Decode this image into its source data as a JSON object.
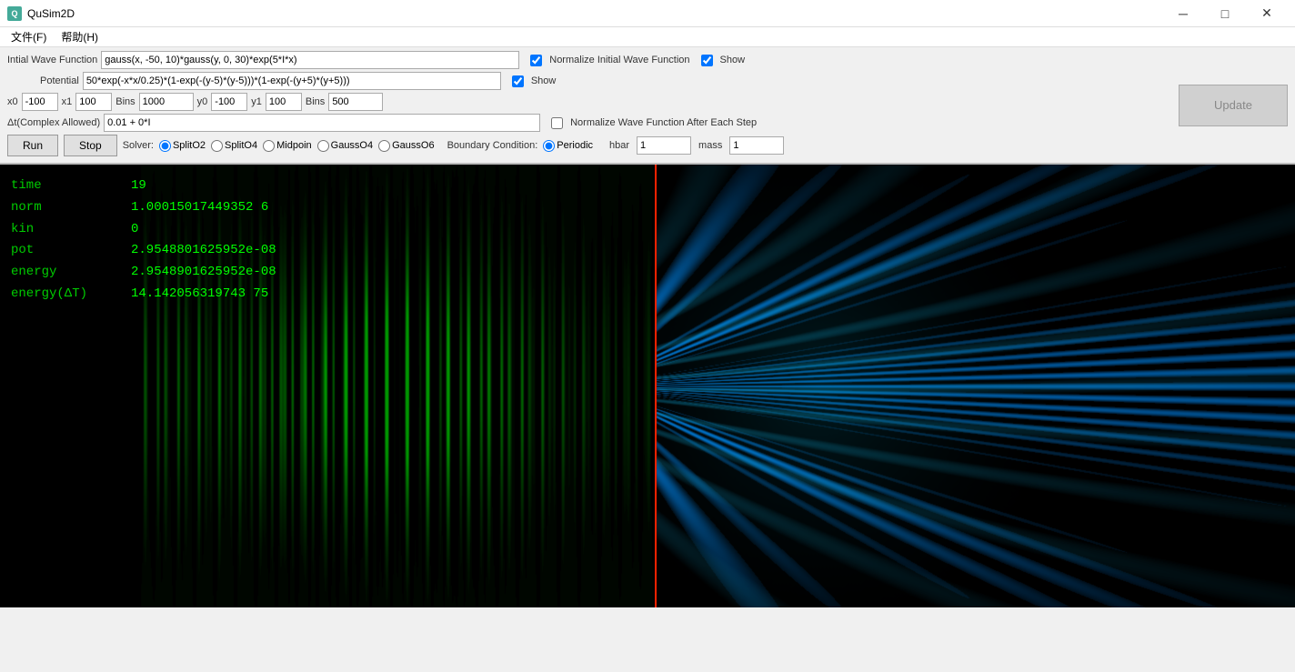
{
  "titlebar": {
    "icon": "Q",
    "title": "QuSim2D",
    "minimize": "─",
    "maximize": "□",
    "close": "✕"
  },
  "menubar": {
    "items": [
      "文件(F)",
      "帮助(H)"
    ]
  },
  "controls": {
    "wave_function_label": "Intial Wave Function",
    "wave_function_value": "gauss(x, -50, 10)*gauss(y, 0, 30)*exp(5*I*x)",
    "normalize_initial_label": "Normalize Initial Wave Function",
    "show_label_1": "Show",
    "potential_label": "Potential",
    "potential_value": "50*exp(-x*x/0.25)*(1-exp(-(y-5)*(y-5)))*(1-exp(-(y+5)*(y+5)))",
    "show_label_2": "Show",
    "x0_label": "x0",
    "x0_value": "-100",
    "x1_label": "x1",
    "x1_value": "100",
    "bins_label_1": "Bins",
    "bins_value_1": "1000",
    "y0_label": "y0",
    "y0_value": "-100",
    "y1_label": "y1",
    "y1_value": "100",
    "bins_label_2": "Bins",
    "bins_value_2": "500",
    "dt_label": "Δt(Complex Allowed)",
    "dt_value": "0.01 + 0*I",
    "normalize_step_label": "Normalize Wave Function After Each Step",
    "update_label": "Update",
    "run_label": "Run",
    "stop_label": "Stop",
    "solver_label": "Solver:",
    "solvers": [
      "SplitO2",
      "SplitO4",
      "Midpoin",
      "GaussO4",
      "GaussO6"
    ],
    "bc_label": "Boundary Condition:",
    "bc_periodic": "Periodic",
    "hbar_label": "hbar",
    "hbar_value": "1",
    "mass_label": "mass",
    "mass_value": "1"
  },
  "simulation": {
    "time_label": "time",
    "time_value": "19",
    "norm_label": "norm",
    "norm_value": "1.00015017449352 6",
    "kin_label": "kin",
    "kin_value": "0",
    "pot_label": "pot",
    "pot_value": "2.9548801625952e-08",
    "energy_label": "energy",
    "energy_value": "2.9548901625952e-08",
    "energy_dt_label": "energy(ΔT)",
    "energy_dt_value": "14.142056319743 75"
  }
}
